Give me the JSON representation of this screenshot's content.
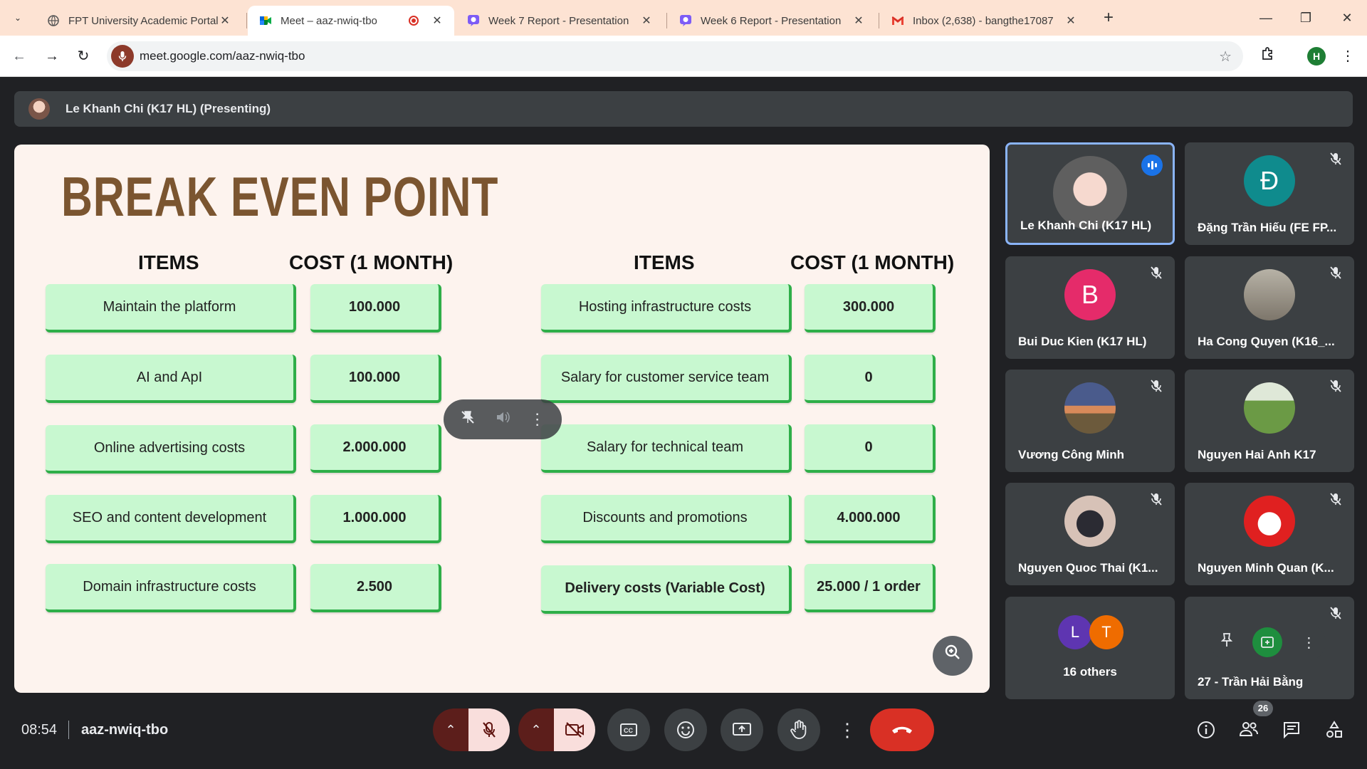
{
  "browser": {
    "tabs": [
      {
        "label": "FPT University Academic Portal",
        "icon": "globe-icon"
      },
      {
        "label": "Meet – aaz-nwiq-tbo",
        "icon": "google-meet-icon",
        "recording": true
      },
      {
        "label": "Week 7 Report - Presentation",
        "icon": "canva-icon"
      },
      {
        "label": "Week 6 Report - Presentation",
        "icon": "canva-icon"
      },
      {
        "label": "Inbox (2,638) - bangthe17087",
        "icon": "gmail-icon"
      }
    ],
    "url": "meet.google.com/aaz-nwiq-tbo",
    "profile_initial": "H"
  },
  "presenter": {
    "name": "Le Khanh Chi (K17 HL) (Presenting)"
  },
  "slide": {
    "title": "BREAK EVEN POINT",
    "left": {
      "items_header": "ITEMS",
      "cost_header": "COST (1 MONTH)",
      "rows": [
        {
          "item": "Maintain the platform",
          "cost": "100.000"
        },
        {
          "item": "AI and ApI",
          "cost": "100.000"
        },
        {
          "item": "Online advertising costs",
          "cost": "2.000.000"
        },
        {
          "item": "SEO and content development",
          "cost": "1.000.000"
        },
        {
          "item": "Domain infrastructure costs",
          "cost": "2.500"
        }
      ]
    },
    "right": {
      "items_header": "ITEMS",
      "cost_header": "COST (1 MONTH)",
      "rows": [
        {
          "item": "Hosting infrastructure costs",
          "cost": "300.000"
        },
        {
          "item": "Salary for customer service team",
          "cost": "0"
        },
        {
          "item": "Salary for technical team",
          "cost": "0"
        },
        {
          "item": "Discounts and promotions",
          "cost": "4.000.000"
        },
        {
          "item": "Delivery costs (Variable Cost)",
          "cost": "25.000 / 1 order"
        }
      ]
    }
  },
  "participants": [
    {
      "name": "Le Khanh Chi (K17 HL)",
      "speaking": true
    },
    {
      "name": "Đặng Trần Hiếu (FE FP...",
      "initial": "Đ",
      "color": "#0f8b8d"
    },
    {
      "name": "Bui Duc Kien (K17 HL)",
      "initial": "B",
      "color": "#e52b6a"
    },
    {
      "name": "Ha Cong Quyen (K16_..."
    },
    {
      "name": "Vương Công Minh"
    },
    {
      "name": "Nguyen Hai Anh K17"
    },
    {
      "name": "Nguyen Quoc Thai (K1..."
    },
    {
      "name": "Nguyen Minh Quan (K..."
    },
    {
      "name": "16 others",
      "others_initials": [
        "L",
        "T"
      ]
    },
    {
      "name": "27 - Trần Hải Bằng"
    }
  ],
  "bottom": {
    "time": "08:54",
    "meeting_code": "aaz-nwiq-tbo",
    "people_count": "26"
  },
  "colors": {
    "meet_bg": "#202124",
    "tile_bg": "#3c4043",
    "end_call": "#d93025",
    "slide_title": "#7b5530",
    "cell_fill": "#c8f8d0",
    "cell_border": "#2eae48",
    "tab_bar": "#fde3d3"
  }
}
